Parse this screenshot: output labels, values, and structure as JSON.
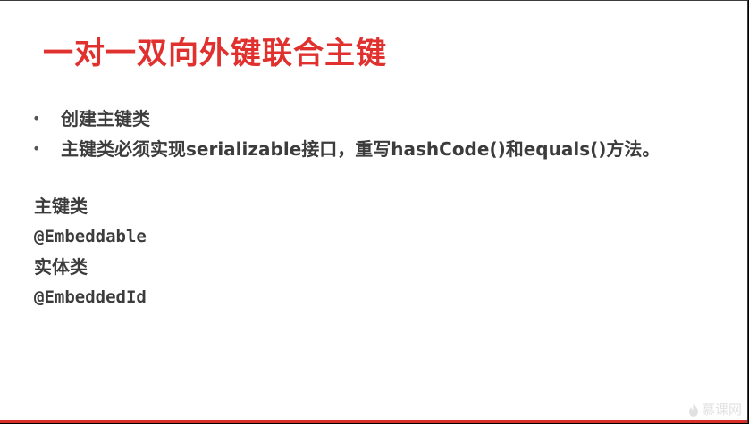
{
  "slide": {
    "title": "一对一双向外键联合主键",
    "bullets": [
      {
        "text": "创建主键类"
      },
      {
        "text": "主键类必须实现serializable接口，重写hashCode()和equals()方法。"
      }
    ],
    "bullet_symbol": "•",
    "primary_key_class_label": "主键类",
    "primary_key_annotation": "@Embeddable",
    "entity_class_label": "实体类",
    "entity_annotation": "@EmbeddedId"
  },
  "watermark": {
    "text": "慕课网",
    "icon": "flame-icon"
  },
  "colors": {
    "title": "#e0312f",
    "body_text": "#3c3c3c",
    "accent_bar": "#d92f2b",
    "background": "#ffffff",
    "frame": "#000000"
  }
}
